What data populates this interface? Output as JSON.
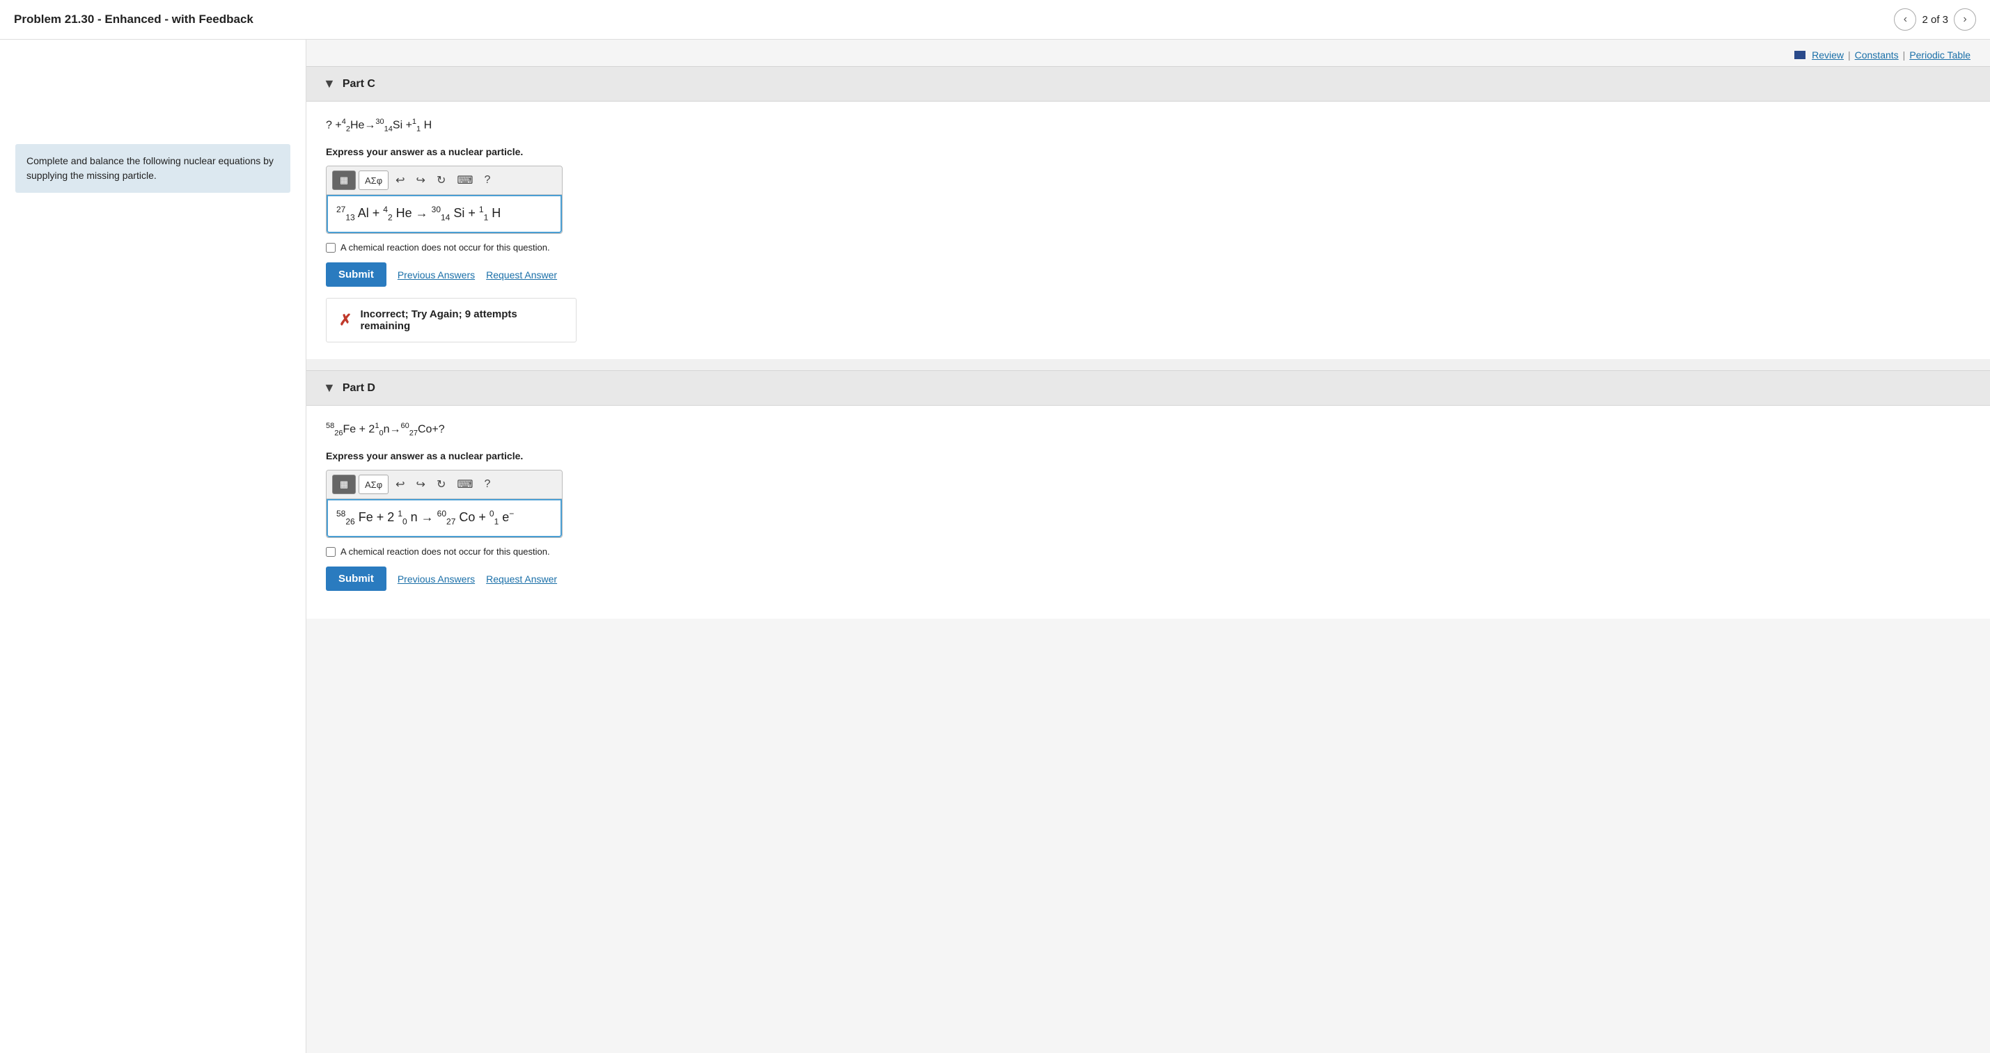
{
  "header": {
    "title": "Problem 21.30 - Enhanced - with Feedback",
    "nav_prev": "‹",
    "nav_next": "›",
    "nav_count": "2 of 3"
  },
  "top_links": {
    "review_label": "Review",
    "constants_label": "Constants",
    "periodic_table_label": "Periodic Table",
    "pipe": "|"
  },
  "sidebar": {
    "instruction": "Complete and balance the following nuclear equations by supplying the missing particle."
  },
  "part_c": {
    "label": "Part C",
    "equation_display": "? +⁴₂He→³⁰₁₄Si +¹₁H",
    "instruction": "Express your answer as a nuclear particle.",
    "toolbar": {
      "matrix_btn": "▦",
      "alpha_btn": "ΑΣφ",
      "undo_icon": "↩",
      "redo_icon": "↪",
      "refresh_icon": "↺",
      "keyboard_icon": "⌨",
      "help_icon": "?"
    },
    "math_input": "²⁷₁₃Al + ⁴₂He → ³⁰₁₄Si + ¹₁H",
    "checkbox_label": "A chemical reaction does not occur for this question.",
    "submit_label": "Submit",
    "previous_answers_label": "Previous Answers",
    "request_answer_label": "Request Answer",
    "feedback_text": "Incorrect; Try Again; 9 attempts remaining"
  },
  "part_d": {
    "label": "Part D",
    "equation_display": "⁵⁸₂₆Fe + 2¹₀n→⁶⁰₂₇Co+?",
    "instruction": "Express your answer as a nuclear particle.",
    "toolbar": {
      "matrix_btn": "▦",
      "alpha_btn": "ΑΣφ",
      "undo_icon": "↩",
      "redo_icon": "↪",
      "refresh_icon": "↺",
      "keyboard_icon": "⌨",
      "help_icon": "?"
    },
    "math_input": "⁵⁸₂₆Fe + 2¹₀n → ⁶⁰₂₇Co + ⁰₁e⁻",
    "checkbox_label": "A chemical reaction does not occur for this question.",
    "submit_label": "Submit",
    "previous_answers_label": "Previous Answers",
    "request_answer_label": "Request Answer"
  }
}
